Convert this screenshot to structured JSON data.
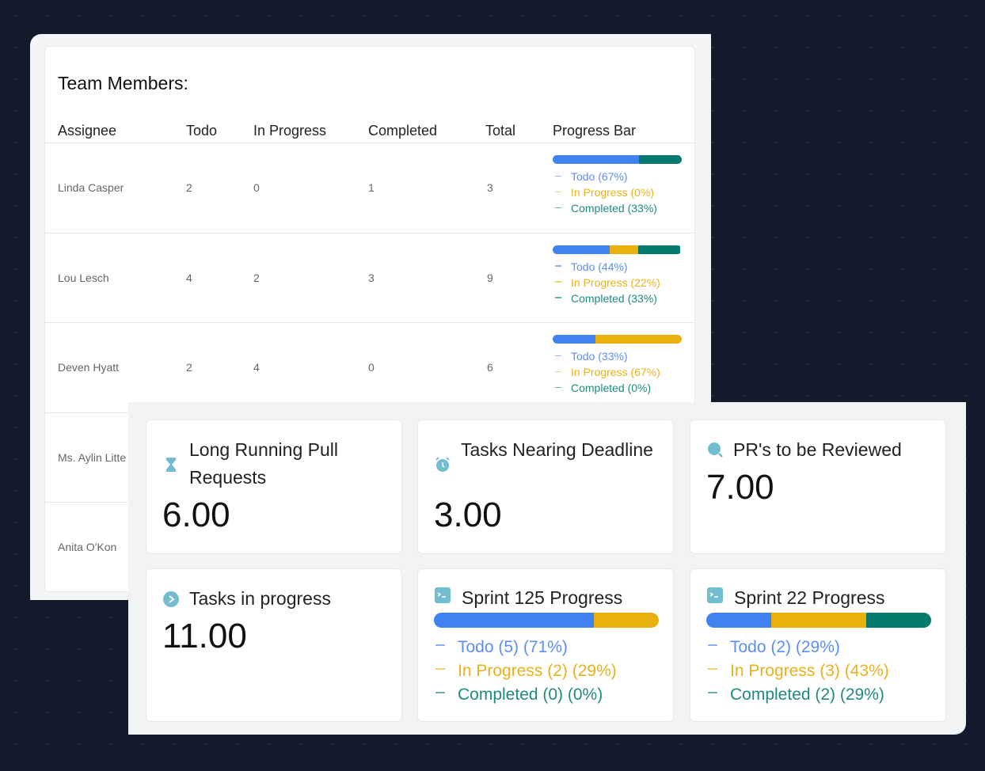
{
  "team": {
    "title": "Team Members:",
    "headers": [
      "Assignee",
      "Todo",
      "In Progress",
      "Completed",
      "Total",
      "Progress Bar"
    ],
    "rows": [
      {
        "name": "Linda Casper",
        "todo": "2",
        "ip": "0",
        "done": "1",
        "total": "3",
        "p": [
          67,
          0,
          33
        ],
        "legend": [
          "Todo (67%)",
          "In Progress (0%)",
          "Completed (33%)"
        ]
      },
      {
        "name": "Lou Lesch",
        "todo": "4",
        "ip": "2",
        "done": "3",
        "total": "9",
        "p": [
          44,
          22,
          33
        ],
        "legend": [
          "Todo (44%)",
          "In Progress (22%)",
          "Completed (33%)"
        ]
      },
      {
        "name": "Deven Hyatt",
        "todo": "2",
        "ip": "4",
        "done": "0",
        "total": "6",
        "p": [
          33,
          67,
          0
        ],
        "legend": [
          "Todo (33%)",
          "In Progress (67%)",
          "Completed (0%)"
        ]
      },
      {
        "name": "Ms. Aylin Litte"
      },
      {
        "name": "Anita O'Kon"
      }
    ]
  },
  "metrics": [
    {
      "title": "Long Running Pull Requests",
      "value": "6.00",
      "icon": "hourglass-icon"
    },
    {
      "title": "Tasks Nearing Deadline",
      "value": "3.00",
      "icon": "alarm-clock-icon"
    },
    {
      "title": "PR's to be Reviewed",
      "value": "7.00",
      "icon": "magnify-icon"
    },
    {
      "title": "Tasks in progress",
      "value": "11.00",
      "icon": "play-circle-icon"
    }
  ],
  "sprints": [
    {
      "title": "Sprint 125 Progress",
      "p": [
        71,
        29,
        0
      ],
      "legend": [
        "Todo (5) (71%)",
        "In Progress (2) (29%)",
        "Completed (0) (0%)"
      ]
    },
    {
      "title": "Sprint 22 Progress",
      "p": [
        29,
        43,
        29
      ],
      "legend": [
        "Todo (2) (29%)",
        "In Progress (3) (43%)",
        "Completed (2) (29%)"
      ]
    }
  ],
  "colors": {
    "todo": "#3f82f0",
    "in_progress": "#e8b10e",
    "completed": "#077a70"
  }
}
